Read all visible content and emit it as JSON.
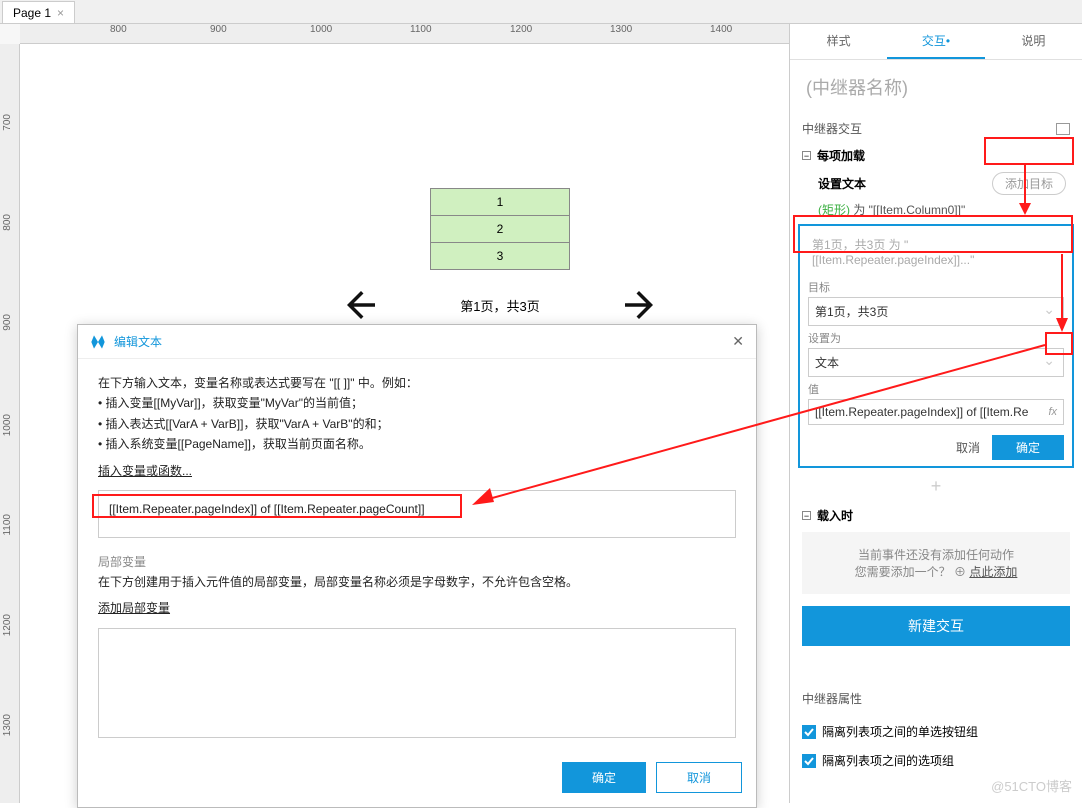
{
  "tab": {
    "label": "Page 1"
  },
  "ruler_h": [
    "800",
    "900",
    "1000",
    "1100",
    "1200",
    "1300",
    "1400"
  ],
  "ruler_v": [
    "700",
    "800",
    "900",
    "1000",
    "1100",
    "1200",
    "1300"
  ],
  "repeater": {
    "rows": [
      "1",
      "2",
      "3"
    ]
  },
  "pager": {
    "label": "第1页，共3页"
  },
  "side": {
    "tabs": {
      "style": "样式",
      "interact": "交互",
      "note": "说明"
    },
    "widget_name": "(中继器名称)",
    "section_title": "中继器交互",
    "event_name": "每项加载",
    "action_name": "设置文本",
    "add_target": "添加目标",
    "desc_green": "(矩形)",
    "desc_rest": " 为 \"[[Item.Column0]]\"",
    "cfg_summary": "第1页，共3页 为 \"[[Item.Repeater.pageIndex]]...\"",
    "target_label": "目标",
    "target_value": "第1页，共3页",
    "setas_label": "设置为",
    "setas_value": "文本",
    "value_label": "值",
    "value_value": "[[Item.Repeater.pageIndex]] of [[Item.Re",
    "fx": "fx",
    "cancel": "取消",
    "ok": "确定",
    "event2": "载入时",
    "empty_line1": "当前事件还没有添加任何动作",
    "empty_line2_a": "您需要添加一个？",
    "empty_line2_b": "点此添加",
    "new_interaction": "新建交互",
    "props_title": "中继器属性",
    "chk1": "隔离列表项之间的单选按钮组",
    "chk2": "隔离列表项之间的选项组"
  },
  "modal": {
    "title": "编辑文本",
    "instr1": "在下方输入文本，变量名称或表达式要写在 \"[[ ]]\" 中。例如：",
    "b1": "• 插入变量[[MyVar]]，获取变量\"MyVar\"的当前值；",
    "b2": "• 插入表达式[[VarA + VarB]]，获取\"VarA + VarB\"的和；",
    "b3": "• 插入系统变量[[PageName]]，获取当前页面名称。",
    "insert": "插入变量或函数...",
    "expression": "[[Item.Repeater.pageIndex]] of [[Item.Repeater.pageCount]]",
    "local_var_hdr": "局部变量",
    "local_var_desc": "在下方创建用于插入元件值的局部变量，局部变量名称必须是字母数字，不允许包含空格。",
    "add_local": "添加局部变量",
    "ok": "确定",
    "cancel": "取消"
  },
  "watermark": "@51CTO博客"
}
